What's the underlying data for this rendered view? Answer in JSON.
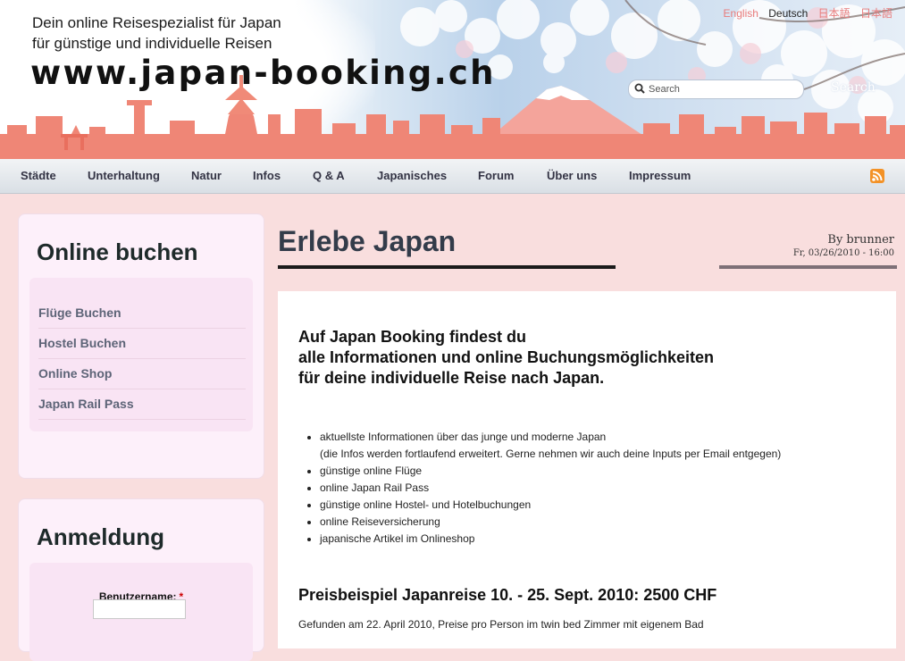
{
  "header": {
    "tagline_1": "Dein online Reisespezialist für Japan",
    "tagline_2": "für günstige und individuelle Reisen",
    "site_url": "www.japan-booking.ch",
    "languages": [
      {
        "label": "English",
        "active": false
      },
      {
        "label": "Deutsch",
        "active": true
      },
      {
        "label": "日本語",
        "active": false
      },
      {
        "label": "日本語",
        "active": false
      }
    ],
    "search": {
      "placeholder": "Search",
      "button_label": "Search"
    }
  },
  "nav": {
    "items": [
      "Städte",
      "Unterhaltung",
      "Natur",
      "Infos",
      "Q & A",
      "Japanisches",
      "Forum",
      "Über uns",
      "Impressum"
    ]
  },
  "sidebar": {
    "booking": {
      "title": "Online buchen",
      "links": [
        "Flüge Buchen",
        "Hostel Buchen",
        "Online Shop",
        "Japan Rail Pass"
      ]
    },
    "login": {
      "title": "Anmeldung",
      "username_label": "Benutzername:",
      "required_mark": "*"
    }
  },
  "article": {
    "title": "Erlebe Japan",
    "author": "By brunner",
    "date": "Fr, 03/26/2010 - 16:00",
    "intro_lines": [
      "Auf Japan Booking findest du",
      "alle Informationen und online Buchungsmöglichkeiten",
      "für deine individuelle Reise nach Japan."
    ],
    "bullets": [
      {
        "text": "aktuellste Informationen über das junge und moderne Japan",
        "sub": "(die Infos werden fortlaufend erweitert. Gerne nehmen wir auch deine Inputs per Email entgegen)"
      },
      {
        "text": "günstige online Flüge",
        "sub": ""
      },
      {
        "text": "online Japan Rail Pass",
        "sub": ""
      },
      {
        "text": "günstige online Hostel- und Hotelbuchungen",
        "sub": ""
      },
      {
        "text": "online Reiseversicherung",
        "sub": ""
      },
      {
        "text": "japanische Artikel im Onlineshop",
        "sub": ""
      }
    ],
    "price_heading": "Preisbeispiel Japanreise 10. - 25. Sept. 2010: 2500 CHF",
    "found_text": "Gefunden am 22. April 2010, Preise pro Person im twin bed Zimmer mit eigenem Bad"
  },
  "colors": {
    "page_bg": "#f9dede",
    "skyline": "#f08070",
    "nav_text": "#333344",
    "sidebar_link": "#5d6477",
    "rss": "#f39227"
  }
}
